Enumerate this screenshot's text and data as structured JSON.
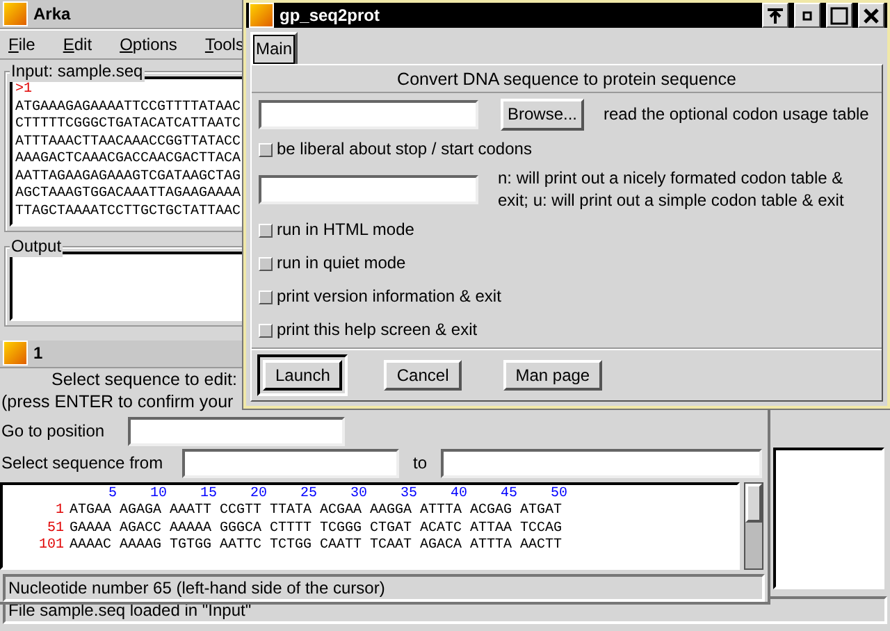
{
  "main_window": {
    "title": "Arka",
    "menu": [
      {
        "label": "File"
      },
      {
        "label": "Edit"
      },
      {
        "label": "Options"
      },
      {
        "label": "Tools"
      }
    ],
    "input": {
      "label": "Input: sample.seq",
      "header": ">1",
      "lines": [
        "ATGAAAGAGAAAATTCCGTTTTATAAC",
        "CTTTTTCGGGCTGATACATCATTAATC",
        "ATTTAAACTTAACAAACCGGTTATACC",
        "AAAGACTCAAACGACCAACGACTTACA",
        "AATTAGAAGAGAAAGTCGATAAGCTAG",
        "AGCTAAAGTGGACAAATTAGAAGAAAA",
        "TTAGCTAAAATCCTTGCTGCTATTAAC"
      ]
    },
    "output": {
      "label": "Output"
    },
    "status_bar": "File sample.seq loaded in \"Input\""
  },
  "sequence_window": {
    "title": "1",
    "prompt": "Select sequence to edit:",
    "hint": "(press ENTER to confirm your",
    "goto_label": "Go to position",
    "range_label": "Select sequence from",
    "to_label": "to",
    "ruler": [
      "5",
      "10",
      "15",
      "20",
      "25",
      "30",
      "35",
      "40",
      "45",
      "50"
    ],
    "rows": [
      {
        "number": "1",
        "sequence": "ATGAA AGAGA AAATT CCGTT TTATA ACGAA AAGGA ATTTA ACGAG ATGAT"
      },
      {
        "number": "51",
        "sequence": "GAAAA AGACC AAAAA GGGCA CTTTT TCGGG CTGAT ACATC ATTAA TCCAG"
      },
      {
        "number": "101",
        "sequence": "AAAAC AAAAG TGTGG AATTC TCTGG CAATT TCAAT AGACA ATTTA AACTT"
      }
    ],
    "status": "Nucleotide number 65 (left-hand side of the cursor)"
  },
  "dialog": {
    "title": "gp_seq2prot",
    "tabs": [
      {
        "label": "Main",
        "selected": true
      }
    ],
    "heading": "Convert DNA sequence to protein sequence",
    "options": [
      {
        "kind": "file",
        "button": "Browse...",
        "description": "read the optional codon usage table"
      },
      {
        "kind": "checkbox",
        "label": "be liberal about stop / start codons",
        "checked": false
      },
      {
        "kind": "text",
        "description": "n: will print out a nicely formated codon table & exit; u: will print out a simple codon table & exit"
      },
      {
        "kind": "checkbox",
        "label": "run in HTML mode",
        "checked": false
      },
      {
        "kind": "checkbox",
        "label": "run in quiet mode",
        "checked": false
      },
      {
        "kind": "checkbox",
        "label": "print version information & exit",
        "checked": false
      },
      {
        "kind": "checkbox",
        "label": "print this help screen & exit",
        "checked": false
      }
    ],
    "buttons": [
      {
        "label": "Launch",
        "default": true
      },
      {
        "label": "Cancel",
        "default": false
      },
      {
        "label": "Man page",
        "default": false
      }
    ]
  }
}
